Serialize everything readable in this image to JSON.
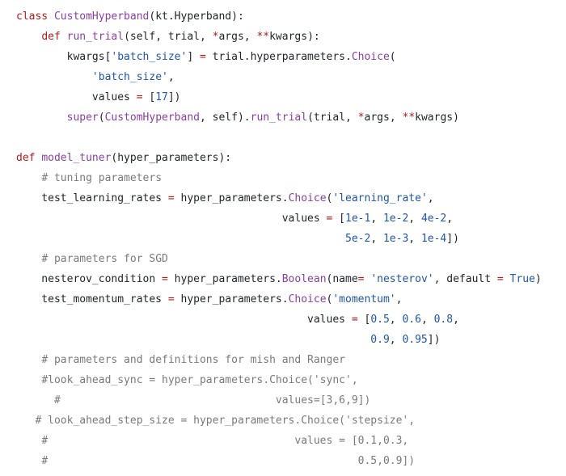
{
  "colors": {
    "background": "#ffffff",
    "default": "#1f2328",
    "keyword": "#b31b1b",
    "builtin": "#8a3fa3",
    "string": "#1f56a8",
    "number": "#1f56a8",
    "comment": "#7a7a7a"
  },
  "code": {
    "lines": [
      [
        {
          "t": "class ",
          "c": "keyword"
        },
        {
          "t": "CustomHyperband",
          "c": "builtin"
        },
        {
          "t": "(kt.Hyperband):",
          "c": "default"
        }
      ],
      [
        {
          "t": "    ",
          "c": "default"
        },
        {
          "t": "def ",
          "c": "keyword"
        },
        {
          "t": "run_trial",
          "c": "builtin"
        },
        {
          "t": "(self, trial, ",
          "c": "default"
        },
        {
          "t": "*",
          "c": "keyword"
        },
        {
          "t": "args, ",
          "c": "default"
        },
        {
          "t": "**",
          "c": "keyword"
        },
        {
          "t": "kwargs):",
          "c": "default"
        }
      ],
      [
        {
          "t": "        kwargs[",
          "c": "default"
        },
        {
          "t": "'batch_size'",
          "c": "string"
        },
        {
          "t": "] ",
          "c": "default"
        },
        {
          "t": "=",
          "c": "keyword"
        },
        {
          "t": " trial.hyperparameters.",
          "c": "default"
        },
        {
          "t": "Choice",
          "c": "builtin"
        },
        {
          "t": "(",
          "c": "default"
        }
      ],
      [
        {
          "t": "            ",
          "c": "default"
        },
        {
          "t": "'batch_size'",
          "c": "string"
        },
        {
          "t": ",",
          "c": "default"
        }
      ],
      [
        {
          "t": "            values ",
          "c": "default"
        },
        {
          "t": "=",
          "c": "keyword"
        },
        {
          "t": " [",
          "c": "default"
        },
        {
          "t": "17",
          "c": "number"
        },
        {
          "t": "])",
          "c": "default"
        }
      ],
      [
        {
          "t": "        ",
          "c": "default"
        },
        {
          "t": "super",
          "c": "builtin"
        },
        {
          "t": "(",
          "c": "default"
        },
        {
          "t": "CustomHyperband",
          "c": "builtin"
        },
        {
          "t": ", self).",
          "c": "default"
        },
        {
          "t": "run_trial",
          "c": "builtin"
        },
        {
          "t": "(trial, ",
          "c": "default"
        },
        {
          "t": "*",
          "c": "keyword"
        },
        {
          "t": "args, ",
          "c": "default"
        },
        {
          "t": "**",
          "c": "keyword"
        },
        {
          "t": "kwargs)",
          "c": "default"
        }
      ],
      [],
      [
        {
          "t": "def ",
          "c": "keyword"
        },
        {
          "t": "model_tuner",
          "c": "builtin"
        },
        {
          "t": "(hyper_parameters):",
          "c": "default"
        }
      ],
      [
        {
          "t": "    ",
          "c": "default"
        },
        {
          "t": "# tuning parameters",
          "c": "comment"
        }
      ],
      [
        {
          "t": "    test_learning_rates ",
          "c": "default"
        },
        {
          "t": "=",
          "c": "keyword"
        },
        {
          "t": " hyper_parameters.",
          "c": "default"
        },
        {
          "t": "Choice",
          "c": "builtin"
        },
        {
          "t": "(",
          "c": "default"
        },
        {
          "t": "'learning_rate'",
          "c": "string"
        },
        {
          "t": ",",
          "c": "default"
        }
      ],
      [
        {
          "t": "                                          values ",
          "c": "default"
        },
        {
          "t": "=",
          "c": "keyword"
        },
        {
          "t": " [",
          "c": "default"
        },
        {
          "t": "1e-1",
          "c": "number"
        },
        {
          "t": ", ",
          "c": "default"
        },
        {
          "t": "1e-2",
          "c": "number"
        },
        {
          "t": ", ",
          "c": "default"
        },
        {
          "t": "4e-2",
          "c": "number"
        },
        {
          "t": ",",
          "c": "default"
        }
      ],
      [
        {
          "t": "                                                    ",
          "c": "default"
        },
        {
          "t": "5e-2",
          "c": "number"
        },
        {
          "t": ", ",
          "c": "default"
        },
        {
          "t": "1e-3",
          "c": "number"
        },
        {
          "t": ", ",
          "c": "default"
        },
        {
          "t": "1e-4",
          "c": "number"
        },
        {
          "t": "])",
          "c": "default"
        }
      ],
      [
        {
          "t": "    ",
          "c": "default"
        },
        {
          "t": "# parameters for SGD",
          "c": "comment"
        }
      ],
      [
        {
          "t": "    nesterov_condition ",
          "c": "default"
        },
        {
          "t": "=",
          "c": "keyword"
        },
        {
          "t": " hyper_parameters.",
          "c": "default"
        },
        {
          "t": "Boolean",
          "c": "builtin"
        },
        {
          "t": "(name",
          "c": "default"
        },
        {
          "t": "=",
          "c": "keyword"
        },
        {
          "t": " ",
          "c": "default"
        },
        {
          "t": "'nesterov'",
          "c": "string"
        },
        {
          "t": ", default ",
          "c": "default"
        },
        {
          "t": "=",
          "c": "keyword"
        },
        {
          "t": " ",
          "c": "default"
        },
        {
          "t": "True",
          "c": "string"
        },
        {
          "t": ")",
          "c": "default"
        }
      ],
      [
        {
          "t": "    test_momentum_rates ",
          "c": "default"
        },
        {
          "t": "=",
          "c": "keyword"
        },
        {
          "t": " hyper_parameters.",
          "c": "default"
        },
        {
          "t": "Choice",
          "c": "builtin"
        },
        {
          "t": "(",
          "c": "default"
        },
        {
          "t": "'momentum'",
          "c": "string"
        },
        {
          "t": ",",
          "c": "default"
        }
      ],
      [
        {
          "t": "                                              values ",
          "c": "default"
        },
        {
          "t": "=",
          "c": "keyword"
        },
        {
          "t": " [",
          "c": "default"
        },
        {
          "t": "0.5",
          "c": "number"
        },
        {
          "t": ", ",
          "c": "default"
        },
        {
          "t": "0.6",
          "c": "number"
        },
        {
          "t": ", ",
          "c": "default"
        },
        {
          "t": "0.8",
          "c": "number"
        },
        {
          "t": ",",
          "c": "default"
        }
      ],
      [
        {
          "t": "                                                        ",
          "c": "default"
        },
        {
          "t": "0.9",
          "c": "number"
        },
        {
          "t": ", ",
          "c": "default"
        },
        {
          "t": "0.95",
          "c": "number"
        },
        {
          "t": "])",
          "c": "default"
        }
      ],
      [
        {
          "t": "    ",
          "c": "default"
        },
        {
          "t": "# parameters and definitions for mish and Ranger",
          "c": "comment"
        }
      ],
      [
        {
          "t": "    ",
          "c": "default"
        },
        {
          "t": "#look_ahead_sync = hyper_parameters.Choice('sync',",
          "c": "comment"
        }
      ],
      [
        {
          "t": "      ",
          "c": "default"
        },
        {
          "t": "#                                  values=[3,6,9])",
          "c": "comment"
        }
      ],
      [
        {
          "t": "   ",
          "c": "default"
        },
        {
          "t": "# look_ahead_step_size = hyper_parameters.Choice('stepsize',",
          "c": "comment"
        }
      ],
      [
        {
          "t": "    ",
          "c": "default"
        },
        {
          "t": "#                                       values = [0.1,0.3,",
          "c": "comment"
        }
      ],
      [
        {
          "t": "    ",
          "c": "default"
        },
        {
          "t": "#                                                 0.5,0.9])",
          "c": "comment"
        }
      ]
    ]
  }
}
